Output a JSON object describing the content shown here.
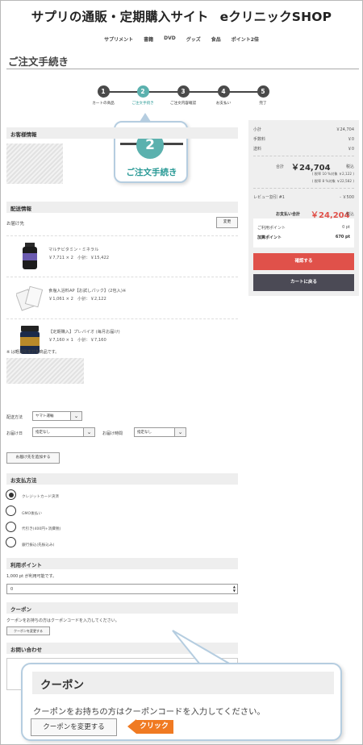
{
  "header": {
    "site_title_part1": "サプリの通販・定期購入サイト",
    "site_title_part2": "eクリニックSHOP",
    "nav": [
      "サプリメント",
      "書籍",
      "DVD",
      "グッズ",
      "食品",
      "ポイント2倍"
    ]
  },
  "page_title": "ご注文手続き",
  "stepper": {
    "steps": [
      {
        "num": "1",
        "label": "カートの商品"
      },
      {
        "num": "2",
        "label": "ご注文手続き"
      },
      {
        "num": "3",
        "label": "ご注文内容確認"
      },
      {
        "num": "4",
        "label": "お支払い"
      },
      {
        "num": "5",
        "label": "完了"
      }
    ],
    "active_index": 2
  },
  "step_callout": {
    "num": "2",
    "label": "ご注文手続き"
  },
  "customer": {
    "heading": "お客様情報"
  },
  "delivery": {
    "heading": "配送情報",
    "dest_label": "お届け先",
    "change_button": "変更",
    "products": [
      {
        "name": "マルチビタミン・ミネラル",
        "price": "￥7,711 × 2　小計：￥15,422"
      },
      {
        "name": "食塩入浴料AP【お試しパック】(2包入)※",
        "price": "￥1,061 × 2　小計：￥2,122"
      },
      {
        "name": "【定期購入】プレバイオ (毎月お届け)",
        "price": "￥7,160 × 1　小計：￥7,160"
      }
    ],
    "note": "※ は軽減税率対象商品です。",
    "method_label": "配送方法",
    "method_value": "ヤマト運輸",
    "date_label": "お届け日",
    "date_value": "指定なし",
    "time_label": "お届け時間",
    "time_value": "指定なし",
    "add_dest_button": "お届け先を追加する"
  },
  "payment": {
    "heading": "お支払方法",
    "options": [
      "クレジットカード決済",
      "GMO後払い",
      "代引き(400円+消費税)",
      "銀行振込(先振込み)"
    ],
    "selected": "クレジットカード決済"
  },
  "points": {
    "heading": "利用ポイント",
    "available": "1,000 pt が利用可能です。",
    "value": "0"
  },
  "coupon": {
    "heading": "クーポン",
    "desc": "クーポンをお持ちの方はクーポンコードを入力してください。",
    "button": "クーポンを変更する"
  },
  "inquiry": {
    "heading": "お問い合わせ"
  },
  "summary": {
    "subtotal_label": "小計",
    "subtotal": "￥24,704",
    "fee_label": "手数料",
    "fee": "￥0",
    "shipping_label": "送料",
    "shipping": "￥0",
    "total_label": "合計",
    "total": "￥24,704",
    "total_suffix": "税込",
    "tax10": "( 税率 10 %対象 ￥2,122 )",
    "tax8": "( 税率 8 %対象 ￥22,582 )",
    "review_label": "レビュー割引 #1",
    "review": "- ￥500",
    "pay_label": "お支払い合計",
    "pay": "￥24,204",
    "pay_suffix": "税込",
    "use_points_label": "ご利用ポイント",
    "use_points": "0 pt",
    "earn_points_label": "加算ポイント",
    "earn_points": "670 pt",
    "confirm_button": "確認する",
    "back_button": "カートに戻る"
  },
  "bottom_callout": {
    "heading": "クーポン",
    "desc": "クーポンをお持ちの方はクーポンコードを入力してください。",
    "button": "クーポンを変更する",
    "click_label": "クリック"
  },
  "colors": {
    "accent": "#5bb1ae",
    "confirm": "#e0514a",
    "dark_button": "#4b4a55",
    "click_badge": "#f07a22"
  }
}
